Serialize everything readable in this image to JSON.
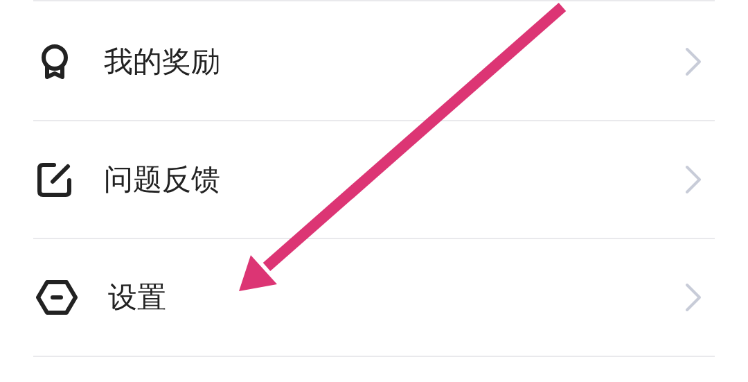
{
  "menu": [
    {
      "kind": "award",
      "label": "我的奖励"
    },
    {
      "kind": "feedback",
      "label": "问题反馈"
    },
    {
      "kind": "settings",
      "label": "设置"
    }
  ],
  "annotation": {
    "kind": "arrow"
  }
}
